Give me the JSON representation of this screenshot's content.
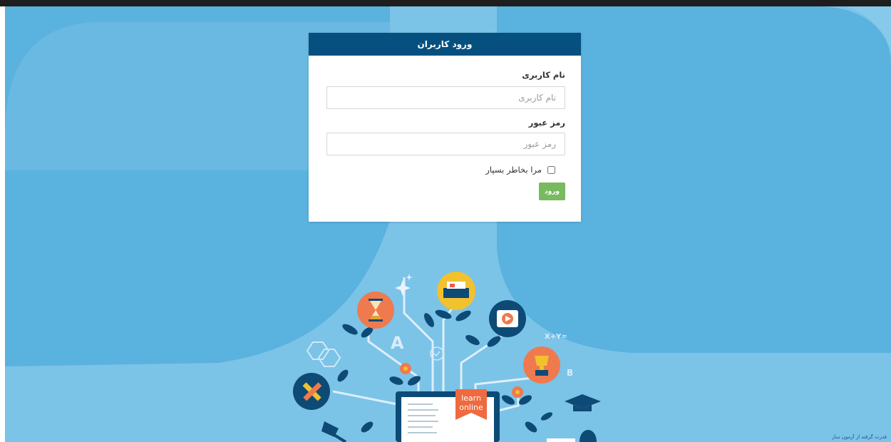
{
  "login": {
    "title": "ورود کاربران",
    "username_label": "نام کاربری",
    "username_placeholder": "نام کاربری",
    "username_value": "",
    "password_label": "رمز عبور",
    "password_placeholder": "رمز عبور",
    "password_value": "",
    "remember_label": "مرا بخاطر بسپار",
    "remember_checked": false,
    "submit_label": "ورود"
  },
  "illustration": {
    "badge_text_line1": "learn",
    "badge_text_line2": "online",
    "letter_a": "A",
    "letter_b": "B",
    "formula": "X+Y="
  },
  "footer": {
    "credit": "قدرت گرفته از آزمون ساز"
  },
  "colors": {
    "background": "#5ab2de",
    "header": "#06507f",
    "submit": "#79ba60",
    "topbar": "#1e1e1e"
  }
}
